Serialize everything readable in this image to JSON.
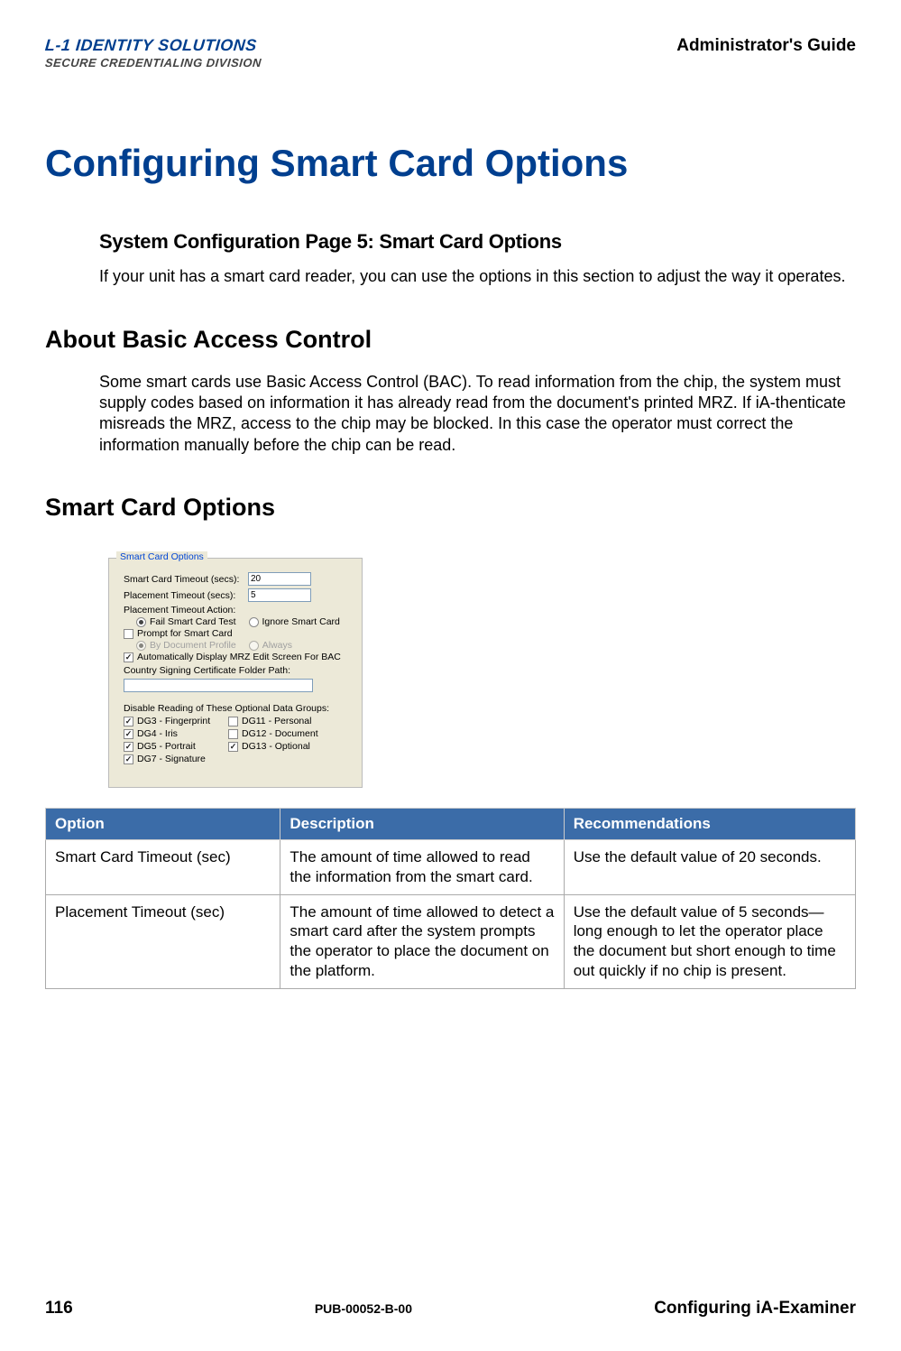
{
  "header": {
    "logo_line1": "L-1 IDENTITY SOLUTIONS",
    "logo_line2": "SECURE CREDENTIALING DIVISION",
    "guide_title": "Administrator's Guide"
  },
  "title": "Configuring Smart Card Options",
  "section1": {
    "heading": "System Configuration Page 5: Smart Card Options",
    "text": "If your unit has a smart card reader, you can use the options in this section to adjust the way it operates."
  },
  "section2": {
    "heading": "About Basic Access Control",
    "text": "Some smart cards use Basic Access Control (BAC). To read information from the chip, the system must supply codes based on information it has already read from the document's printed MRZ. If iA-thenticate misreads the MRZ, access to the chip may be blocked. In this case the operator must correct the information manually before the chip can be read."
  },
  "section3": {
    "heading": "Smart Card Options"
  },
  "panel": {
    "legend": "Smart Card Options",
    "timeout_label": "Smart Card Timeout (secs):",
    "timeout_value": "20",
    "placement_label": "Placement Timeout (secs):",
    "placement_value": "5",
    "placement_action_label": "Placement Timeout Action:",
    "radio_fail": "Fail Smart Card Test",
    "radio_ignore": "Ignore Smart Card",
    "prompt_label": "Prompt for Smart Card",
    "radio_profile": "By Document Profile",
    "radio_always": "Always",
    "auto_mrz_label": "Automatically Display MRZ Edit Screen For BAC",
    "cert_path_label": "Country Signing Certificate Folder Path:",
    "cert_path_value": "",
    "dg_heading": "Disable Reading of These Optional Data Groups:",
    "dg3": "DG3 - Fingerprint",
    "dg4": "DG4 - Iris",
    "dg5": "DG5 - Portrait",
    "dg7": "DG7 - Signature",
    "dg11": "DG11 - Personal",
    "dg12": "DG12 - Document",
    "dg13": "DG13 - Optional"
  },
  "table": {
    "headers": {
      "option": "Option",
      "description": "Description",
      "recommendations": "Recommendations"
    },
    "rows": [
      {
        "option": "Smart Card Timeout (sec)",
        "description": "The amount of time allowed to read the information from the smart card.",
        "recommendations": "Use the default value of 20 seconds."
      },
      {
        "option": "Placement Timeout (sec)",
        "description": "The amount of time allowed to detect a smart card after the system prompts the operator to place the document on the platform.",
        "recommendations": "Use the default value of 5 seconds— long enough to let the operator place the document but short enough to time out quickly if no chip is present."
      }
    ]
  },
  "footer": {
    "page": "116",
    "pub": "PUB-00052-B-00",
    "title": "Configuring iA-Examiner"
  }
}
